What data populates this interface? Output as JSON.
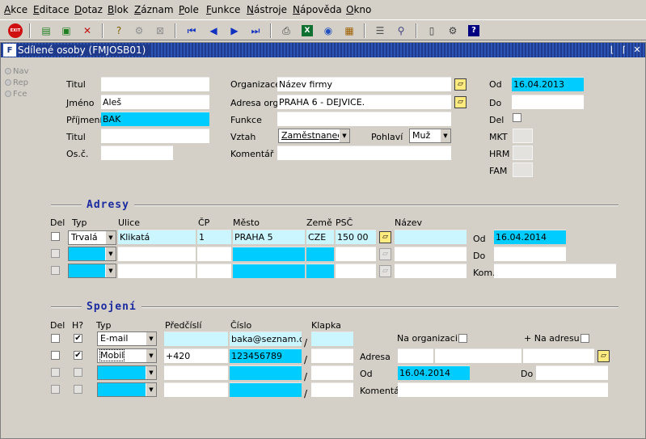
{
  "menu": [
    {
      "u": "A",
      "rest": "kce"
    },
    {
      "u": "E",
      "rest": "ditace"
    },
    {
      "u": "D",
      "rest": "otaz"
    },
    {
      "u": "B",
      "rest": "lok"
    },
    {
      "u": "Z",
      "rest": "áznam"
    },
    {
      "u": "P",
      "rest": "ole"
    },
    {
      "u": "F",
      "rest": "unkce"
    },
    {
      "u": "N",
      "rest": "ástroje"
    },
    {
      "u": "N",
      "rest": "ápověda"
    },
    {
      "u": "O",
      "rest": "kno"
    }
  ],
  "toolbar": {
    "exit_label": "EXIT"
  },
  "window": {
    "icon_text": "F",
    "title": "Sdílené osoby (FMJOSB01)"
  },
  "side_radios": [
    "Nav",
    "Rep",
    "Fce"
  ],
  "person": {
    "titul_label": "Titul",
    "titul_value": "",
    "jmeno_label": "Jméno",
    "jmeno_value": "Aleš",
    "prijmeni_label": "Příjmení",
    "prijmeni_value": "BAK",
    "titul2_label": "Titul",
    "titul2_value": "",
    "osc_label": "Os.č.",
    "osc_value": "",
    "organizace_label": "Organizace",
    "organizace_value": "Název firmy",
    "adresa_org_label": "Adresa org.",
    "adresa_org_value": "PRAHA 6 - DEJVICE.",
    "funkce_label": "Funkce",
    "funkce_value": "",
    "vztah_label": "Vztah",
    "vztah_value": "Zaměstnanec.",
    "pohlavi_label": "Pohlaví",
    "pohlavi_value": "Muž",
    "komentar_label": "Komentář",
    "komentar_value": "",
    "od_label": "Od",
    "od_value": "16.04.2013",
    "do_label": "Do",
    "do_value": "",
    "del_label": "Del",
    "mkt_label": "MKT",
    "hrm_label": "HRM",
    "fam_label": "FAM"
  },
  "adresy": {
    "title": "Adresy",
    "headers": {
      "del": "Del",
      "typ": "Typ",
      "ulice": "Ulice",
      "cp": "ČP",
      "mesto": "Město",
      "zeme": "Země",
      "psc": "PSČ",
      "nazev": "Název"
    },
    "row1": {
      "typ": "Trvalá",
      "ulice": "Klikatá",
      "cp": "1",
      "mesto": "PRAHA  5",
      "zeme": "CZE",
      "psc": "150 00",
      "nazev": ""
    },
    "od_label": "Od",
    "od_value": "16.04.2014",
    "do_label": "Do",
    "do_value": "",
    "kom_label": "Kom.",
    "kom_value": ""
  },
  "spojeni": {
    "title": "Spojení",
    "headers": {
      "del": "Del",
      "h": "H?",
      "typ": "Typ",
      "predcisli": "Předčíslí",
      "cislo": "Číslo",
      "klapka": "Klapka"
    },
    "row1": {
      "h": "✔",
      "typ": "E-mail",
      "predcisli": "",
      "cislo": "baka@seznam.cz",
      "klapka": ""
    },
    "row2": {
      "h": "✔",
      "typ": "Mobil",
      "predcisli": "+420",
      "cislo": "123456789",
      "klapka": ""
    },
    "slash": "/",
    "na_organizaci_label": "Na organizaci",
    "na_adresu_label": "+ Na adresu",
    "adresa_label": "Adresa",
    "od_label": "Od",
    "od_value": "16.04.2014",
    "do_label": "Do",
    "do_value": "",
    "komentar_label": "Komentář",
    "komentar_value": ""
  },
  "colors": {
    "highlight": "#00ccff",
    "light_highlight": "#ccf6ff",
    "section_title": "#1a2aa0",
    "window_title_bg": "#1f3a8a"
  }
}
